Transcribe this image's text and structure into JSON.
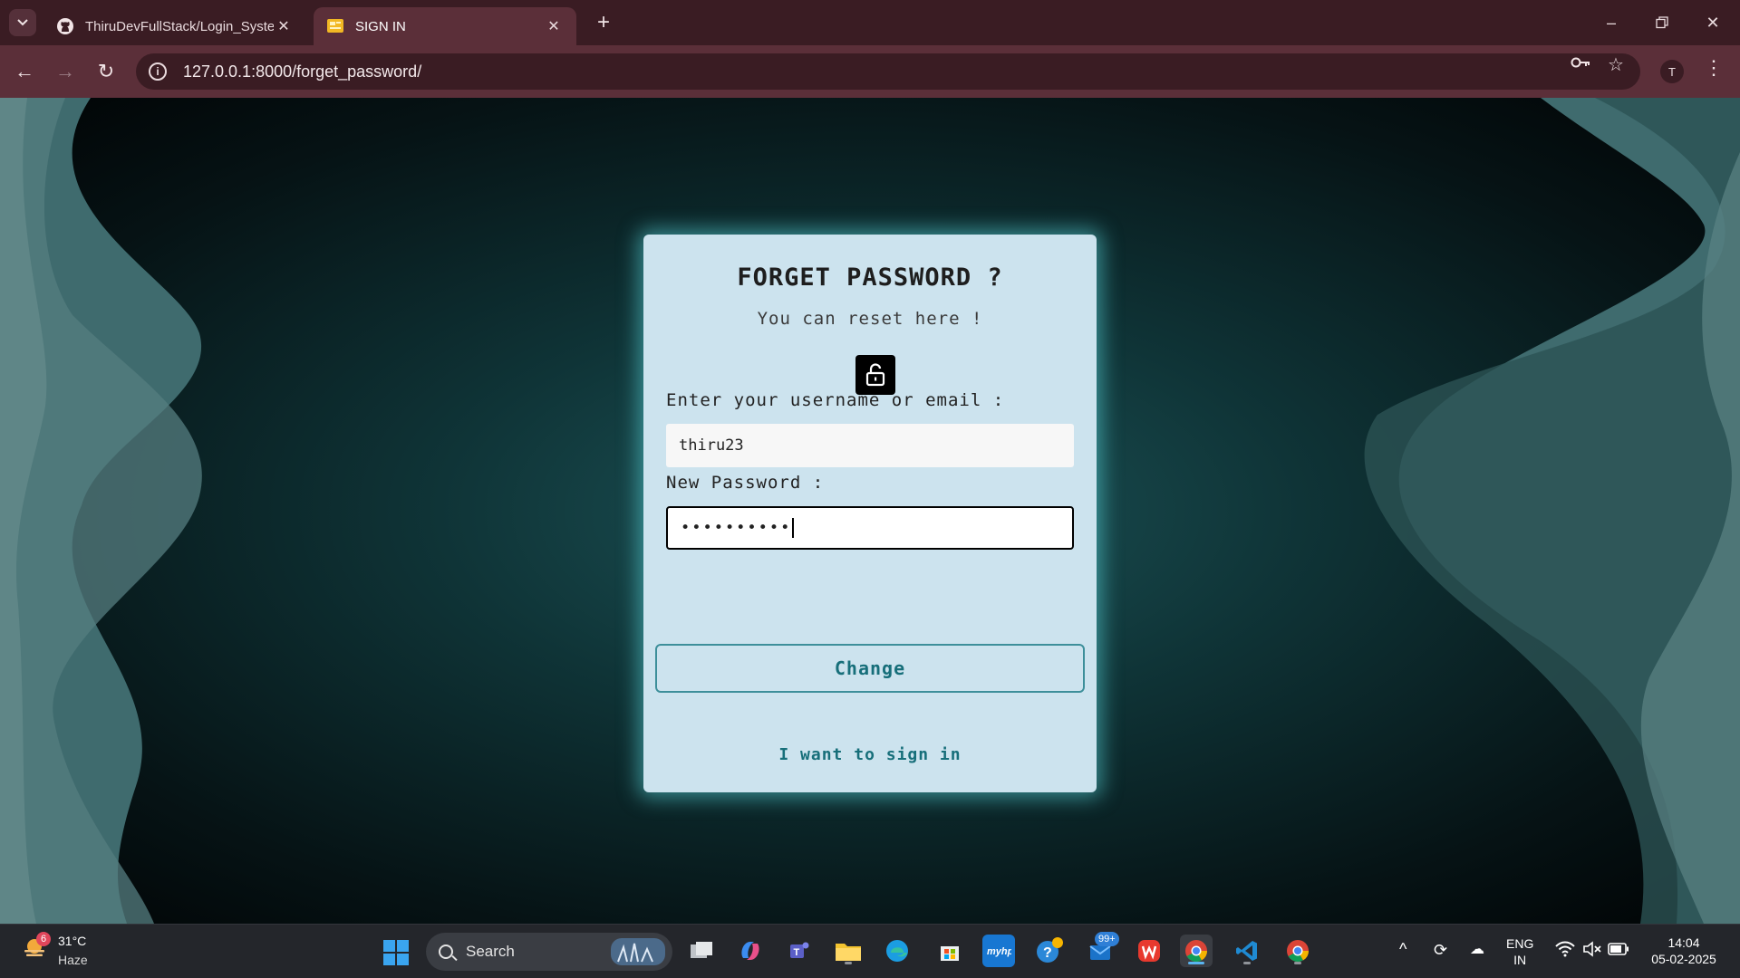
{
  "browser": {
    "tabs": [
      {
        "title": "ThiruDevFullStack/Login_System",
        "favicon": "github-icon"
      },
      {
        "title": "SIGN IN",
        "favicon": "site-icon"
      }
    ],
    "address": "127.0.0.1:8000/forget_password/",
    "profile_initial": "T"
  },
  "form": {
    "title": "FORGET PASSWORD ?",
    "subtitle": "You can reset here !",
    "icon": "unlock-icon",
    "username_label": "Enter your username or email :",
    "username_value": "thiru23",
    "password_label": "New Password :",
    "password_value": "••••••••••",
    "submit_label": "Change",
    "signin_link": "I want to sign in"
  },
  "taskbar": {
    "weather": {
      "badge": "6",
      "temp": "31°C",
      "desc": "Haze"
    },
    "search_label": "Search",
    "store_badge": "99+",
    "language": {
      "top": "ENG",
      "bottom": "IN"
    },
    "time": "14:04",
    "date": "05-02-2025"
  },
  "colors": {
    "card_bg": "#cce3ee",
    "accent": "#176f7a",
    "chrome_bg": "#5b2f39"
  }
}
